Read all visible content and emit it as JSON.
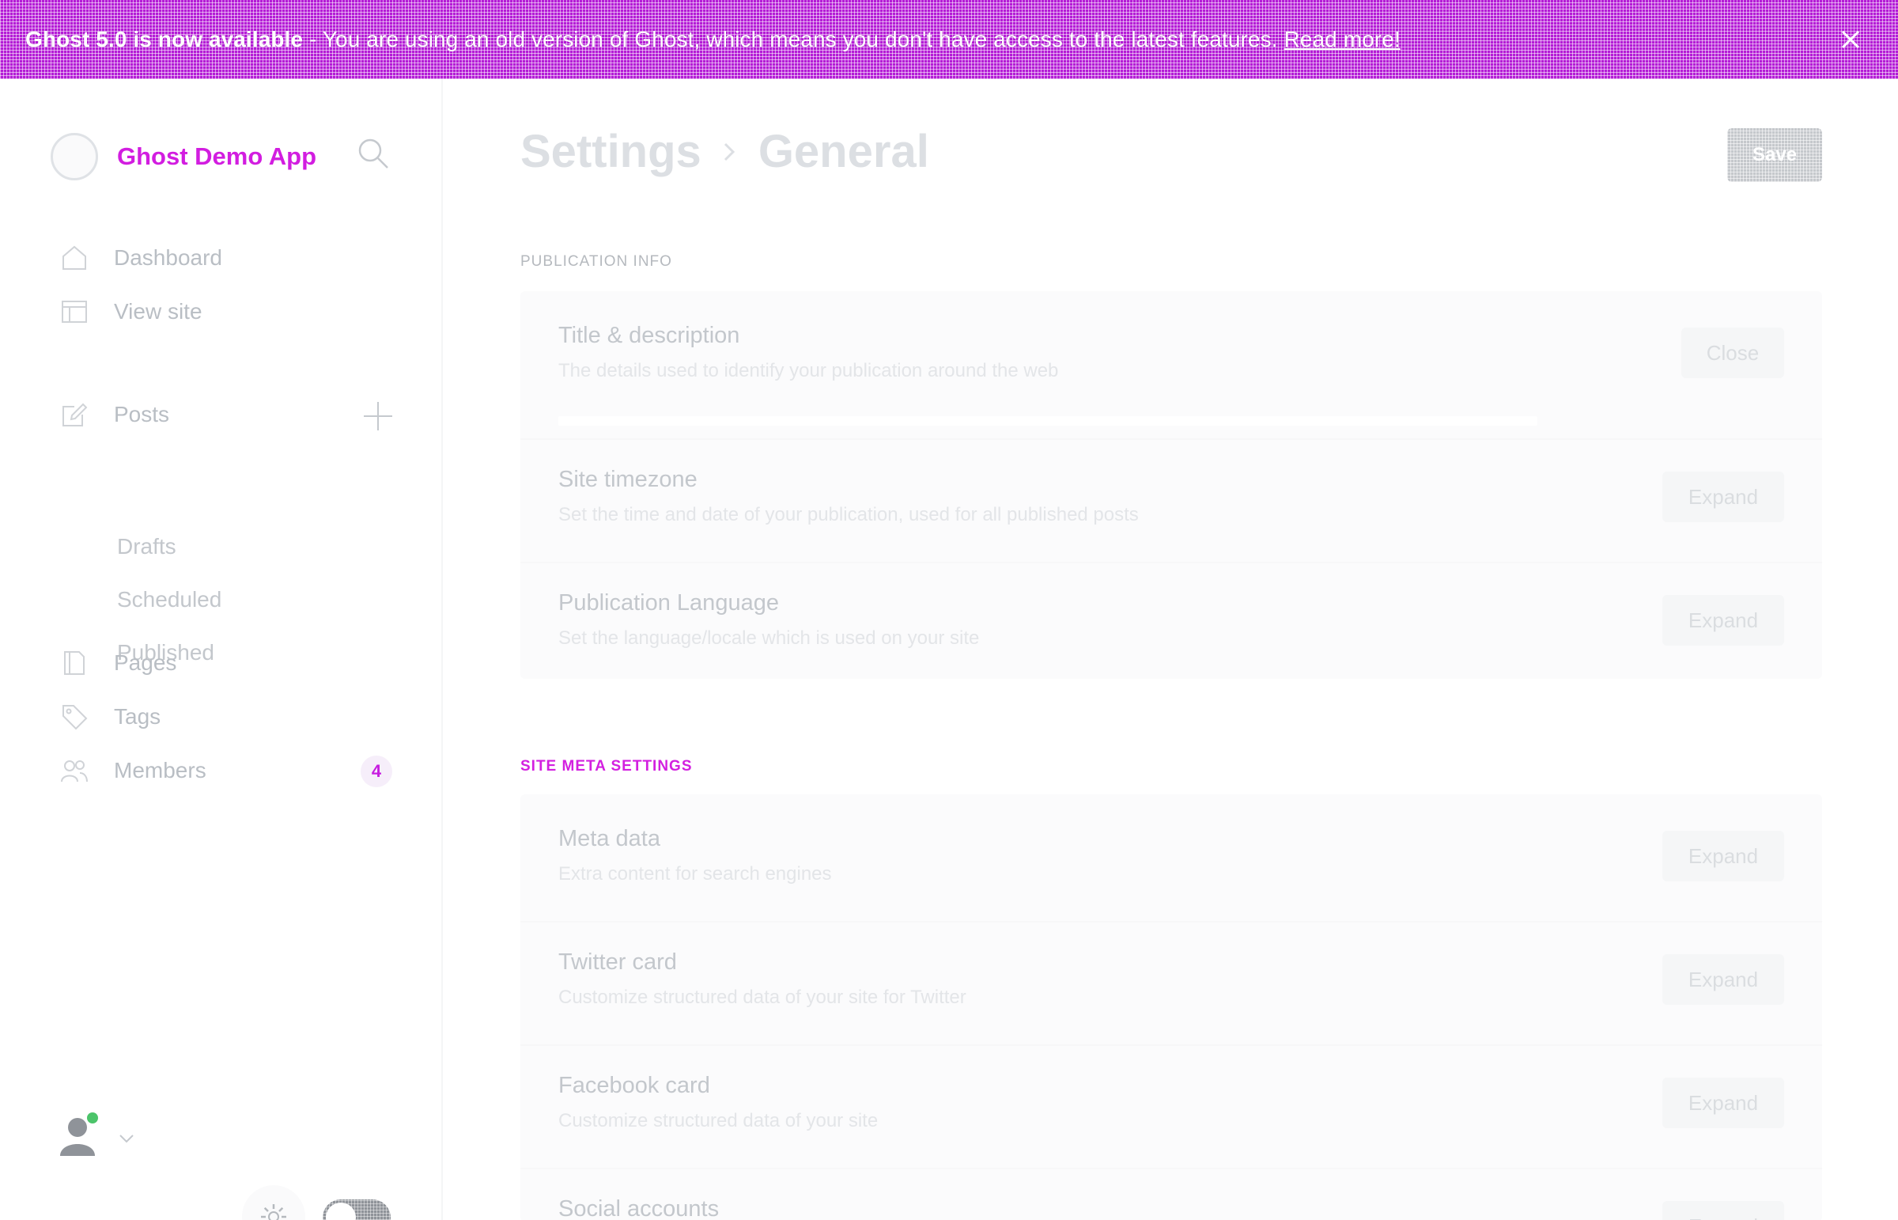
{
  "banner": {
    "text_version": "Ghost 5.0 is now available",
    "text_body": " - You are using an old version of Ghost, which means you don't have access to the latest features.",
    "link": "Read more!",
    "bg_color": "#b41cd6",
    "close_icon": "close-icon"
  },
  "sidebar": {
    "brand": {
      "name": "Ghost Demo App",
      "color": "#d21de0"
    },
    "search_icon": "search-icon",
    "nav": {
      "dashboard": "Dashboard",
      "view_site": "View site",
      "posts": "Posts",
      "drafts": "Drafts",
      "scheduled": "Scheduled",
      "published": "Published",
      "pages": "Pages",
      "tags": "Tags",
      "members": "Members",
      "members_count": "4"
    },
    "footer": {
      "avatar_icon": "user-avatar-icon",
      "chevron_icon": "chevron-down-icon",
      "gear_icon": "gear-icon",
      "toggle_icon": "dark-mode-toggle"
    }
  },
  "main": {
    "breadcrumb": {
      "parent": "Settings",
      "current": "General"
    },
    "save_label": "Save",
    "sections": {
      "publication": {
        "title": "PUBLICATION INFO",
        "items": [
          {
            "title": "Title & description",
            "description": "The details used to identify your publication around the web",
            "button": "Close"
          },
          {
            "title": "Site timezone",
            "description": "Set the time and date of your publication, used for all published posts",
            "button": "Expand"
          },
          {
            "title": "Publication Language",
            "description": "Set the language/locale which is used on your site",
            "button": "Expand"
          }
        ]
      },
      "meta": {
        "title": "SITE META SETTINGS",
        "items": [
          {
            "title": "Meta data",
            "description": "Extra content for search engines",
            "button": "Expand"
          },
          {
            "title": "Twitter card",
            "description": "Customize structured data of your site for Twitter",
            "button": "Expand"
          },
          {
            "title": "Facebook card",
            "description": "Customize structured data of your site",
            "button": "Expand"
          },
          {
            "title": "Social accounts",
            "description": "",
            "button": "Expand"
          }
        ]
      }
    }
  }
}
